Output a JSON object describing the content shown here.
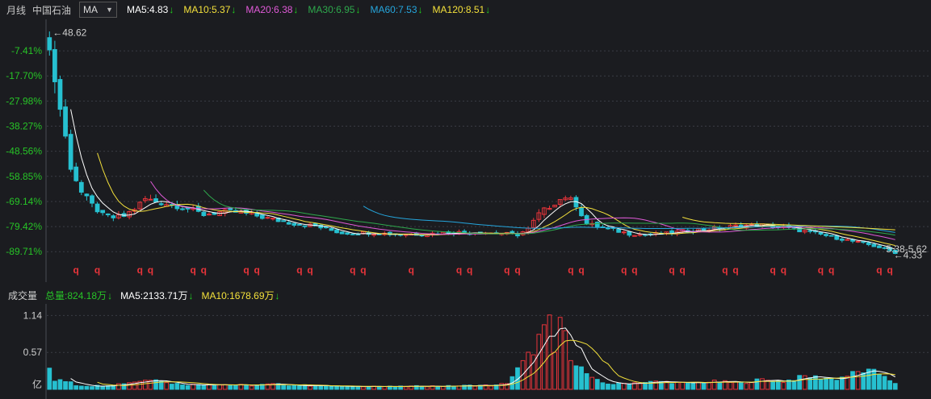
{
  "header": {
    "period": "月线",
    "stock_name": "中国石油",
    "indicator": "MA",
    "ma_legends": [
      {
        "label": "MA5:4.83",
        "color": "#ffffff"
      },
      {
        "label": "MA10:5.37",
        "color": "#f3e03b"
      },
      {
        "label": "MA20:6.38",
        "color": "#e05ad8"
      },
      {
        "label": "MA30:6.95",
        "color": "#2ea84c"
      },
      {
        "label": "MA60:7.53",
        "color": "#25a6dd"
      },
      {
        "label": "MA120:8.51",
        "color": "#f3e03b"
      }
    ],
    "down_arrow": "↓"
  },
  "volume_header": {
    "title": "成交量",
    "total": "总量:824.18万",
    "ma5": "MA5:2133.71万",
    "ma10": "MA10:1678.69万",
    "down_arrow": "↓"
  },
  "colors": {
    "up": "#e8343a",
    "down": "#26c0d0",
    "grid": "#3a3c44",
    "axis_text_green": "#27c427",
    "white_text": "#cfcfcf"
  },
  "chart_data": [
    {
      "type": "candlestick",
      "y_tick_labels": [
        "-7.41%",
        "-17.70%",
        "-27.98%",
        "-38.27%",
        "-48.56%",
        "-58.85%",
        "-69.14%",
        "-79.42%",
        "-89.71%"
      ],
      "y_tick_values": [
        -7.41,
        -17.7,
        -27.98,
        -38.27,
        -48.56,
        -58.85,
        -69.14,
        -79.42,
        -89.71
      ],
      "ylim_percent": [
        -93.6,
        2.2
      ],
      "annotations": {
        "max_price": "48.62",
        "current_range": "5.38-5.62",
        "min_price": "4.33"
      },
      "marker_glyph": "q",
      "marker_indices": [
        5,
        9,
        17,
        19,
        27,
        29,
        37,
        39,
        47,
        49,
        57,
        59,
        68,
        77,
        79,
        86,
        88,
        98,
        100,
        108,
        110,
        117,
        119,
        127,
        129,
        136,
        138,
        145,
        147,
        156,
        158
      ],
      "trend_anchors": [
        [
          0,
          45.0
        ],
        [
          2,
          33.5
        ],
        [
          4,
          22.0
        ],
        [
          6,
          16.8
        ],
        [
          8,
          14.3
        ],
        [
          10,
          12.3
        ],
        [
          12,
          11.8
        ],
        [
          14,
          12.1
        ],
        [
          16,
          13.6
        ],
        [
          18,
          15.5
        ],
        [
          20,
          15.0
        ],
        [
          23,
          14.4
        ],
        [
          26,
          13.6
        ],
        [
          29,
          12.4
        ],
        [
          32,
          12.9
        ],
        [
          35,
          12.9
        ],
        [
          38,
          12.4
        ],
        [
          42,
          11.4
        ],
        [
          46,
          10.6
        ],
        [
          50,
          10.1
        ],
        [
          55,
          8.7
        ],
        [
          60,
          8.8
        ],
        [
          65,
          8.5
        ],
        [
          70,
          8.5
        ],
        [
          75,
          8.8
        ],
        [
          80,
          8.9
        ],
        [
          85,
          8.6
        ],
        [
          88,
          8.4
        ],
        [
          90,
          9.5
        ],
        [
          92,
          12.5
        ],
        [
          95,
          14.8
        ],
        [
          97,
          16.0
        ],
        [
          99,
          14.4
        ],
        [
          101,
          10.6
        ],
        [
          103,
          10.0
        ],
        [
          106,
          9.3
        ],
        [
          109,
          8.6
        ],
        [
          112,
          8.4
        ],
        [
          116,
          8.6
        ],
        [
          120,
          9.2
        ],
        [
          125,
          9.6
        ],
        [
          130,
          10.2
        ],
        [
          134,
          10.3
        ],
        [
          138,
          9.8
        ],
        [
          142,
          9.1
        ],
        [
          146,
          8.2
        ],
        [
          150,
          7.3
        ],
        [
          154,
          6.4
        ],
        [
          157,
          5.6
        ],
        [
          159,
          4.8
        ]
      ],
      "ma_line_order": [
        "MA5",
        "MA10",
        "MA20",
        "MA30",
        "MA60",
        "MA120"
      ]
    },
    {
      "type": "bar",
      "title": "成交量",
      "y_tick_labels": [
        "1.14",
        "0.57"
      ],
      "y_tick_values": [
        1.14,
        0.57
      ],
      "unit_label": "亿",
      "ylim": [
        0,
        1.22
      ],
      "volume_anchors": [
        [
          0,
          0.32
        ],
        [
          1,
          0.13
        ],
        [
          2,
          0.13
        ],
        [
          3,
          0.12
        ],
        [
          4,
          0.13
        ],
        [
          5,
          0.06
        ],
        [
          8,
          0.05
        ],
        [
          12,
          0.07
        ],
        [
          16,
          0.12
        ],
        [
          18,
          0.14
        ],
        [
          20,
          0.18
        ],
        [
          22,
          0.1
        ],
        [
          26,
          0.07
        ],
        [
          30,
          0.08
        ],
        [
          34,
          0.07
        ],
        [
          38,
          0.06
        ],
        [
          42,
          0.08
        ],
        [
          46,
          0.06
        ],
        [
          50,
          0.06
        ],
        [
          55,
          0.04
        ],
        [
          60,
          0.05
        ],
        [
          65,
          0.04
        ],
        [
          70,
          0.05
        ],
        [
          75,
          0.05
        ],
        [
          80,
          0.06
        ],
        [
          84,
          0.06
        ],
        [
          86,
          0.1
        ],
        [
          88,
          0.3
        ],
        [
          90,
          0.5
        ],
        [
          92,
          0.78
        ],
        [
          94,
          0.98
        ],
        [
          95,
          0.55
        ],
        [
          96,
          1.12
        ],
        [
          97,
          0.78
        ],
        [
          98,
          0.55
        ],
        [
          100,
          0.32
        ],
        [
          102,
          0.16
        ],
        [
          104,
          0.1
        ],
        [
          106,
          0.08
        ],
        [
          110,
          0.1
        ],
        [
          115,
          0.12
        ],
        [
          120,
          0.09
        ],
        [
          125,
          0.12
        ],
        [
          130,
          0.1
        ],
        [
          134,
          0.15
        ],
        [
          138,
          0.12
        ],
        [
          142,
          0.2
        ],
        [
          145,
          0.18
        ],
        [
          148,
          0.16
        ],
        [
          151,
          0.24
        ],
        [
          153,
          0.28
        ],
        [
          155,
          0.26
        ],
        [
          157,
          0.22
        ],
        [
          159,
          0.08
        ]
      ]
    }
  ]
}
